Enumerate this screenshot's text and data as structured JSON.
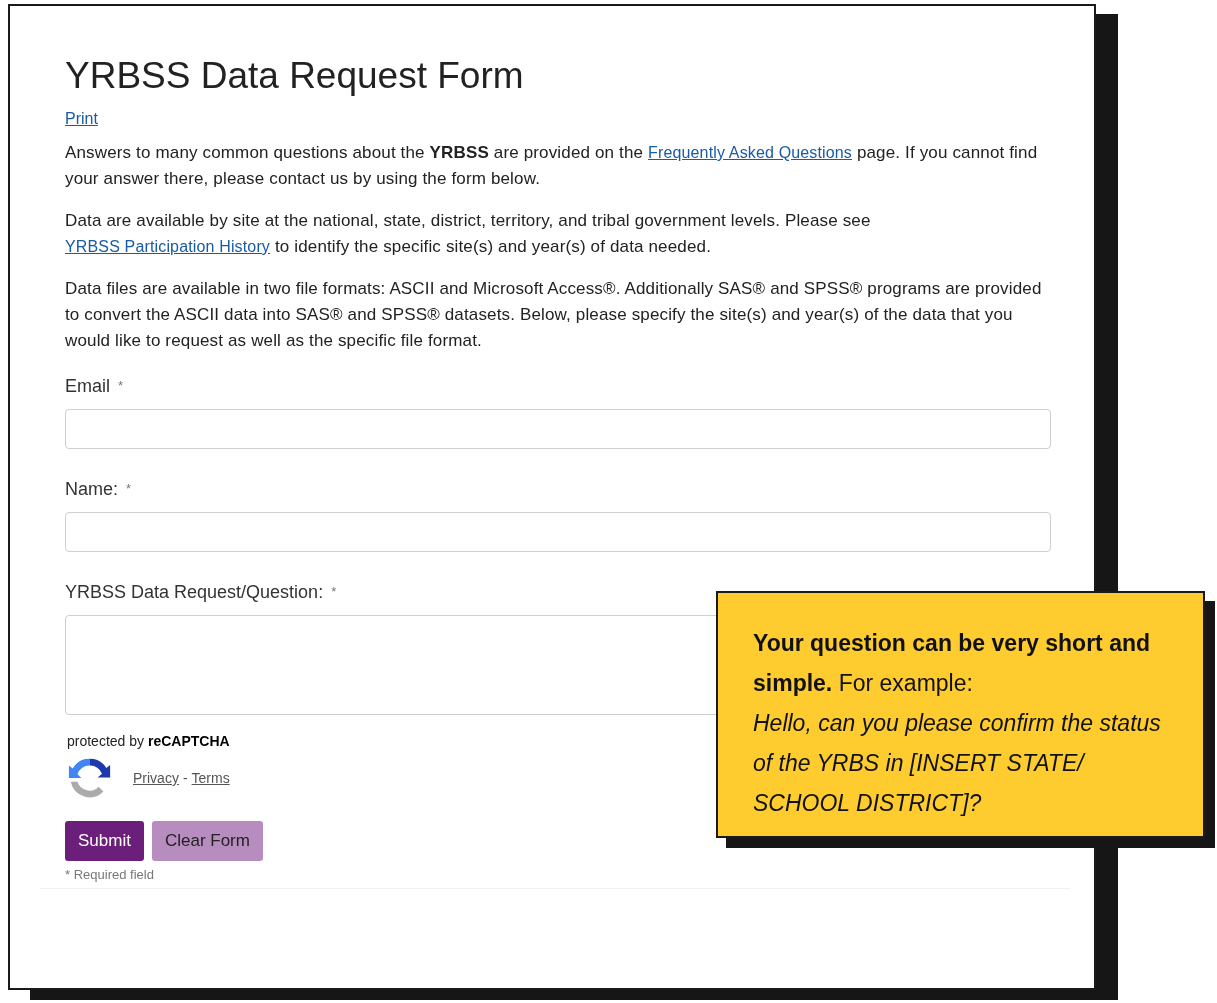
{
  "title": "YRBSS Data Request Form",
  "print_link": "Print",
  "paragraphs": [
    {
      "parts": [
        {
          "kind": "text",
          "text": "Answers to many common questions about the **YRBSS** are provided on the "
        },
        {
          "kind": "link",
          "text": "Frequently Asked Questions"
        },
        {
          "kind": "text",
          "text": " page. If you cannot find your answer there, please contact us by using the form below."
        }
      ]
    },
    {
      "parts": [
        {
          "kind": "text",
          "text": "Data are available by site at the national, state, district, territory, and tribal government levels. Please see "
        },
        {
          "kind": "link",
          "text": "YRBSS Participation History"
        },
        {
          "kind": "text",
          "text": " to identify the specific site(s) and year(s) of data needed."
        }
      ]
    },
    {
      "parts": [
        {
          "kind": "text",
          "text": "Data files are available in two file formats: ASCII and Microsoft Access®. Additionally SAS® and SPSS® programs are provided to convert the ASCII data into SAS® and SPSS® datasets. Below, please specify the site(s) and year(s) of the data that you would like to request as well as the specific file format."
        }
      ]
    }
  ],
  "fields": [
    {
      "kind": "input",
      "label": "Email",
      "required_mark": "*"
    },
    {
      "kind": "input",
      "label": "Name:",
      "required_mark": "*"
    },
    {
      "kind": "textarea",
      "label": "YRBSS Data Request/Question:",
      "required_mark": "*"
    }
  ],
  "recaptcha": {
    "text": "protected by **reCAPTCHA**",
    "privacy": "Privacy",
    "separator": "-",
    "terms": "Terms"
  },
  "buttons": [
    {
      "kind": "primary",
      "label": "Submit"
    },
    {
      "kind": "secondary",
      "label": "Clear Form"
    }
  ],
  "required_note": "* Required field",
  "callout": {
    "intro": "**Your question can be very short and simple.** For example:",
    "example": "Hello, can you please confirm the status of the YRBS in [INSERT STATE/ SCHOOL DISTRICT]?"
  }
}
